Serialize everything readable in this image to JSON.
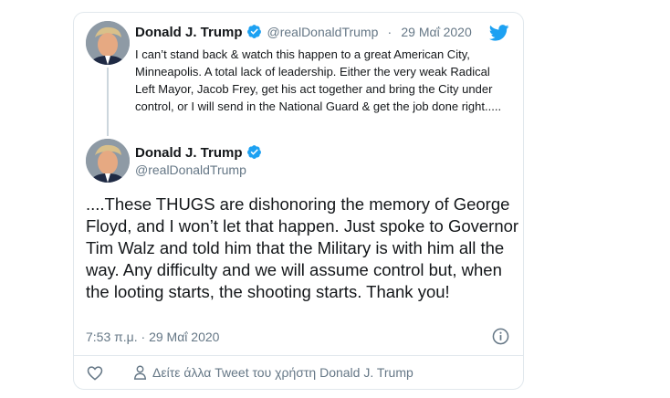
{
  "quoted_tweet": {
    "author_name": "Donald J. Trump",
    "handle": "@realDonaldTrump",
    "separator": "·",
    "date": "29 Μαΐ 2020",
    "text": "I can’t stand back & watch this happen to a great American City, Minneapolis. A total lack of leadership. Either the very weak Radical Left Mayor, Jacob Frey, get his act together and bring the City under control, or I will send in the National Guard & get the job done right....."
  },
  "main_tweet": {
    "author_name": "Donald J. Trump",
    "handle": "@realDonaldTrump",
    "text": "....These THUGS are dishonoring the memory of George Floyd, and I won’t let that happen. Just spoke to Governor Tim Walz and told him that the Military is with him all the way. Any difficulty and we will assume control but, when the looting starts, the shooting starts. Thank you!",
    "timestamp": "7:53 π.μ. · 29 Μαΐ 2020"
  },
  "footer": {
    "more_link": "Δείτε άλλα Tweet του χρήστη Donald J. Trump"
  },
  "colors": {
    "twitter_blue": "#1da1f2",
    "secondary_text": "#657786",
    "border": "#e1e8ed"
  },
  "icons": [
    "verified-badge-icon",
    "twitter-bird-icon",
    "info-icon",
    "heart-icon",
    "person-icon"
  ]
}
